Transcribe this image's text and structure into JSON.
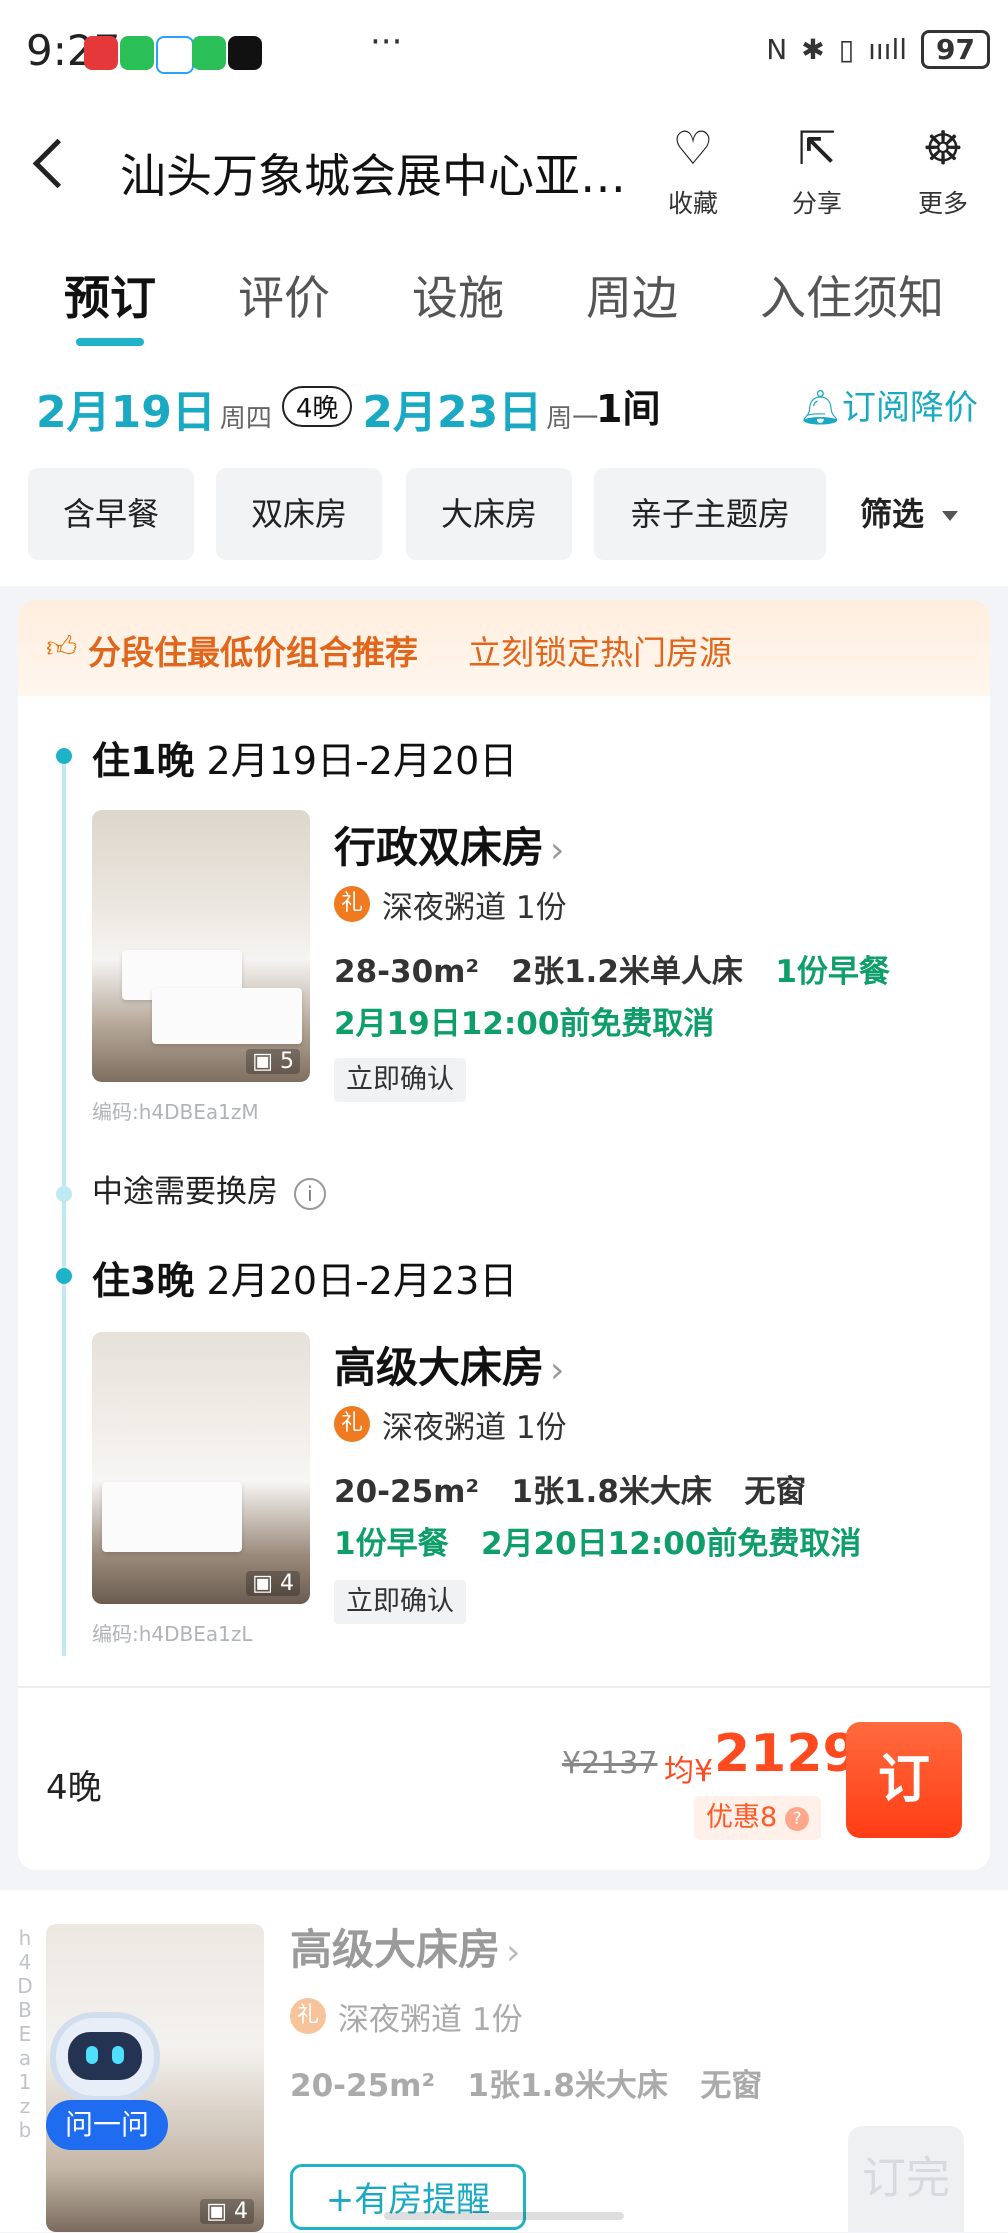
{
  "status": {
    "time": "9:27",
    "dots": "···",
    "battery": "97",
    "signal": "ıııll"
  },
  "header": {
    "title": "汕头万象城会展中心亚…",
    "favorite_label": "收藏",
    "share_label": "分享",
    "more_label": "更多"
  },
  "tabs": [
    "预订",
    "评价",
    "设施",
    "周边",
    "入住须知"
  ],
  "dates": {
    "checkin": "2月19日",
    "checkin_day": "周四",
    "nights": "4晚",
    "checkout": "2月23日",
    "checkout_day": "周一",
    "rooms": "1间",
    "subscribe": "订阅降价"
  },
  "filters": [
    "含早餐",
    "双床房",
    "大床房",
    "亲子主题房"
  ],
  "filter_button": "筛选",
  "combo": {
    "banner_title": "分段住最低价组合推荐",
    "banner_sub": "立刻锁定热门房源",
    "mid_change": "中途需要换房",
    "segments": [
      {
        "stay_nights": "住1晚",
        "stay_dates": "2月19日-2月20日",
        "room_name": "行政双床房",
        "gift_icon": "礼",
        "gift": "深夜粥道 1份",
        "area": "28-30m²",
        "bed": "2张1.2米单人床",
        "breakfast": "1份早餐",
        "cancel": "2月19日12:00前免费取消",
        "confirm": "立即确认",
        "image_count": "5",
        "code": "编码:h4DBEa1zM"
      },
      {
        "stay_nights": "住3晚",
        "stay_dates": "2月20日-2月23日",
        "room_name": "高级大床房",
        "gift_icon": "礼",
        "gift": "深夜粥道 1份",
        "area": "20-25m²",
        "bed": "1张1.8米大床",
        "window": "无窗",
        "breakfast": "1份早餐",
        "cancel": "2月20日12:00前免费取消",
        "confirm": "立即确认",
        "image_count": "4",
        "code": "编码:h4DBEa1zL"
      }
    ],
    "total_nights": "4晚",
    "original_price": "¥2137",
    "avg_prefix": "均¥",
    "price": "2129",
    "discount": "优惠8",
    "discount_q": "?",
    "book_label": "订"
  },
  "room2": {
    "code": "h4DBEa1zb",
    "ask_label": "问一问",
    "room_name": "高级大床房",
    "gift_icon": "礼",
    "gift": "深夜粥道 1份",
    "area": "20-25m²",
    "bed": "1张1.8米大床",
    "window": "无窗",
    "remind_label": "+有房提醒",
    "image_count": "4",
    "book_label": "订完"
  },
  "colors": {
    "accent": "#1fb2c8",
    "price": "#ff4a1f",
    "green": "#0d9e6a",
    "banner": "#e0661b"
  }
}
